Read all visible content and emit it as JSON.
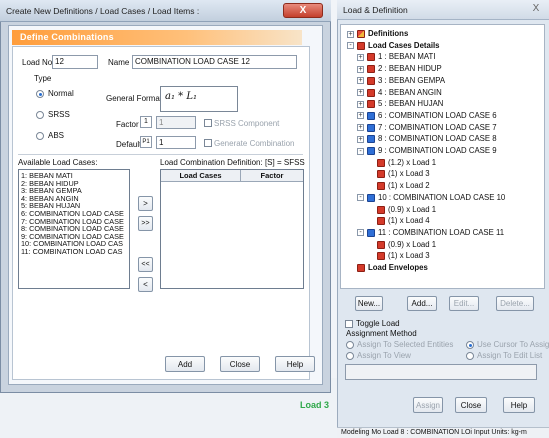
{
  "dialog": {
    "title": "Create New Definitions / Load Cases / Load Items :",
    "close_label": "X",
    "section_header": "Define Combinations",
    "load_no_label": "Load No:",
    "load_no_value": "12",
    "name_label": "Name",
    "name_value": "COMBINATION LOAD CASE 12",
    "type_label": "Type",
    "type_options": [
      "Normal",
      "SRSS",
      "ABS"
    ],
    "type_selected": "Normal",
    "general_format_label": "General Format :",
    "formula": "a₁ * L₁",
    "factor_label": "Factor",
    "factor_icon_text": "1",
    "factor_value": "1",
    "srss_component_label": "SRSS Component",
    "default_label": "Default",
    "default_icon_text": "P1",
    "default_value": "1",
    "generate_combination_label": "Generate Combination",
    "available_label": "Available Load Cases:",
    "available_items": [
      "1: BEBAN MATI",
      "2: BEBAN HIDUP",
      "3: BEBAN GEMPA",
      "4: BEBAN ANGIN",
      "5: BEBAN HUJAN",
      "6: COMBINATION LOAD CASE",
      "7: COMBINATION LOAD CASE",
      "8: COMBINATION LOAD CASE",
      "9: COMBINATION LOAD CASE",
      "10: COMBINATION LOAD CAS",
      "11: COMBINATION LOAD CAS"
    ],
    "definition_label": "Load Combination Definition: [S] = SFSS",
    "col_load_cases": "Load Cases",
    "col_factor": "Factor",
    "btn_add_one": ">",
    "btn_add_all": ">>",
    "btn_remove_all": "<<",
    "btn_remove_one": "<",
    "add_label": "Add",
    "close_label2": "Close",
    "help_label": "Help"
  },
  "background": {
    "load_text": "Load 3"
  },
  "panel": {
    "title": "Load & Definition",
    "close_label": "X",
    "tree": [
      {
        "text": "Definitions",
        "icon": "definitions-icon",
        "bold": true
      },
      {
        "text": "Load Cases Details",
        "icon": "load-cases-folder-icon",
        "bold": true
      },
      {
        "text": "1 : BEBAN MATI",
        "icon": "load-case-icon"
      },
      {
        "text": "2 : BEBAN HIDUP",
        "icon": "load-case-icon"
      },
      {
        "text": "3 : BEBAN GEMPA",
        "icon": "load-case-icon"
      },
      {
        "text": "4 : BEBAN ANGIN",
        "icon": "load-case-icon"
      },
      {
        "text": "5 : BEBAN HUJAN",
        "icon": "load-case-icon"
      },
      {
        "text": "6 : COMBINATION LOAD CASE 6",
        "icon": "combination-icon"
      },
      {
        "text": "7 : COMBINATION LOAD CASE 7",
        "icon": "combination-icon"
      },
      {
        "text": "8 : COMBINATION LOAD CASE 8",
        "icon": "combination-icon"
      },
      {
        "text": "9 : COMBINATION LOAD CASE 9",
        "icon": "combination-icon"
      },
      {
        "text": "(1.2) x Load 1",
        "icon": "load-item-icon"
      },
      {
        "text": "(1) x Load 3",
        "icon": "load-item-icon"
      },
      {
        "text": "(1) x Load 2",
        "icon": "load-item-icon"
      },
      {
        "text": "10 : COMBINATION LOAD CASE 10",
        "icon": "combination-icon"
      },
      {
        "text": "(0.9) x Load 1",
        "icon": "load-item-icon"
      },
      {
        "text": "(1) x Load 4",
        "icon": "load-item-icon"
      },
      {
        "text": "11 : COMBINATION LOAD CASE 11",
        "icon": "combination-icon"
      },
      {
        "text": "(0.9) x Load 1",
        "icon": "load-item-icon"
      },
      {
        "text": "(1) x Load 3",
        "icon": "load-item-icon"
      },
      {
        "text": "Load Envelopes",
        "icon": "envelope-icon",
        "bold": true
      }
    ],
    "new_label": "New...",
    "add_label": "Add...",
    "edit_label": "Edit...",
    "delete_label": "Delete...",
    "toggle_load_label": "Toggle Load",
    "assignment_method_label": "Assignment Method",
    "assign_selected_label": "Assign To Selected Entities",
    "assign_view_label": "Assign To View",
    "use_cursor_label": "Use Cursor To Assign",
    "assign_edit_label": "Assign To Edit List",
    "assign_label": "Assign",
    "close_label2": "Close",
    "help_label": "Help"
  },
  "status_bar": {
    "text": "Modeling Mo  Load 8 : COMBINATION LOi  Input Units:  kg-m"
  }
}
